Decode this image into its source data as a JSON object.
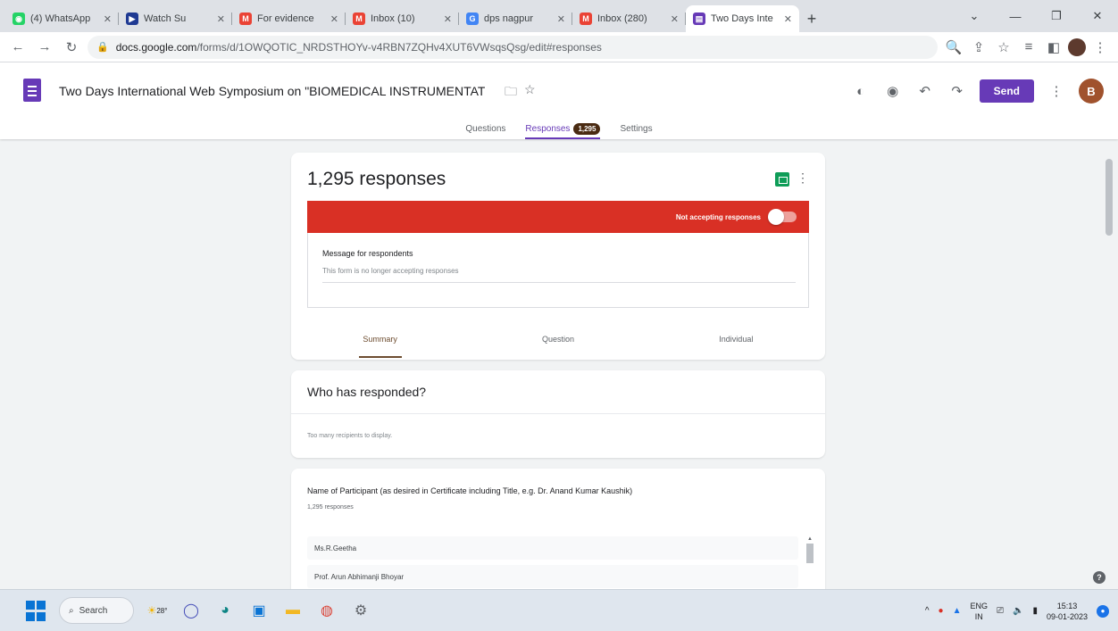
{
  "browser": {
    "tabs": [
      {
        "label": "(4) WhatsApp",
        "color": "#25d366",
        "glyph": "◉"
      },
      {
        "label": "Watch Su",
        "color": "#1f3a93",
        "glyph": "▶"
      },
      {
        "label": "For evidence",
        "color": "#ea4335",
        "glyph": "M"
      },
      {
        "label": "Inbox (10)",
        "color": "#ea4335",
        "glyph": "M"
      },
      {
        "label": "dps nagpur",
        "color": "#4285f4",
        "glyph": "G"
      },
      {
        "label": "Inbox (280)",
        "color": "#ea4335",
        "glyph": "M"
      },
      {
        "label": "Two Days Inte",
        "color": "#673ab7",
        "glyph": "▤"
      }
    ],
    "url_host": "docs.google.com",
    "url_path": "/forms/d/1OWQOTIC_NRDSTHOYv-v4RBN7ZQHv4XUT6VWsqsQsg/edit#responses"
  },
  "form": {
    "title": "Two Days International Web Symposium on \"BIOMEDICAL INSTRUMENTAT",
    "send_label": "Send",
    "avatar_letter": "B",
    "tabs": {
      "questions": "Questions",
      "responses": "Responses",
      "responses_count": "1,295",
      "settings": "Settings"
    }
  },
  "responses": {
    "title": "1,295 responses",
    "accepting_label": "Not accepting responses",
    "message_label": "Message for respondents",
    "message_value": "This form is no longer accepting responses",
    "subtabs": {
      "summary": "Summary",
      "question": "Question",
      "individual": "Individual"
    }
  },
  "who": {
    "title": "Who has responded?",
    "subtitle": "Too many recipients to display."
  },
  "question": {
    "title": "Name of Participant (as desired in Certificate including Title, e.g. Dr. Anand Kumar Kaushik)",
    "count": "1,295 responses",
    "answers": [
      "Ms.R.Geetha",
      "Prof. Arun Abhimanji Bhoyar"
    ]
  },
  "taskbar": {
    "search": "Search",
    "weather": "28°",
    "lang_top": "ENG",
    "lang_bottom": "IN",
    "time": "15:13",
    "date": "09-01-2023"
  }
}
